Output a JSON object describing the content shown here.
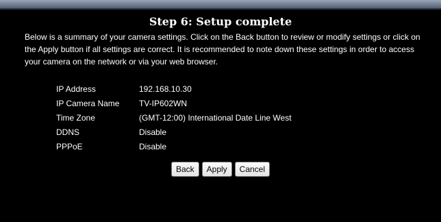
{
  "title": "Step 6: Setup complete",
  "intro": "Below is a summary of your camera settings. Click on the Back button to review or modify settings or click on the Apply button if all settings are correct. It is recommended to note down these settings in order to access your camera on the network or via your web browser.",
  "summary": [
    {
      "label": "IP Address",
      "value": "192.168.10.30"
    },
    {
      "label": "IP Camera Name",
      "value": "TV-IP602WN"
    },
    {
      "label": "Time Zone",
      "value": "(GMT-12:00) International Date Line West"
    },
    {
      "label": "DDNS",
      "value": "Disable"
    },
    {
      "label": "PPPoE",
      "value": "Disable"
    }
  ],
  "buttons": {
    "back": "Back",
    "apply": "Apply",
    "cancel": "Cancel"
  },
  "colors": {
    "background": "#000000",
    "text": "#ffffff"
  }
}
